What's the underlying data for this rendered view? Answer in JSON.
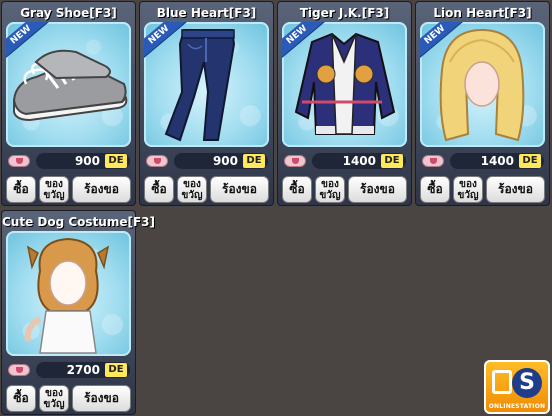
{
  "shop": {
    "new_label": "NEW",
    "buttons": {
      "buy": "ซื้อ",
      "gift": "ของขวัญ",
      "request": "ร้องขอ"
    },
    "items": [
      {
        "name": "Gray Shoe[F3]",
        "price": "900",
        "currency": "DE",
        "icon": "gray-shoe-icon"
      },
      {
        "name": "Blue Heart[F3]",
        "price": "900",
        "currency": "DE",
        "icon": "blue-jeans-icon"
      },
      {
        "name": "Tiger J.K.[F3]",
        "price": "1400",
        "currency": "DE",
        "icon": "tiger-jacket-icon"
      },
      {
        "name": "Lion Heart[F3]",
        "price": "1400",
        "currency": "DE",
        "icon": "blonde-hair-icon"
      },
      {
        "name": "Cute Dog Costume[F3]",
        "price": "2700",
        "currency": "DE",
        "icon": "dog-costume-icon"
      }
    ]
  },
  "logo": {
    "letter": "S",
    "text": "ONLINESTATION"
  },
  "colors": {
    "currency_badge": "#ffe85a",
    "new_badge": "#2b5bb8",
    "background": "#4a4442"
  }
}
